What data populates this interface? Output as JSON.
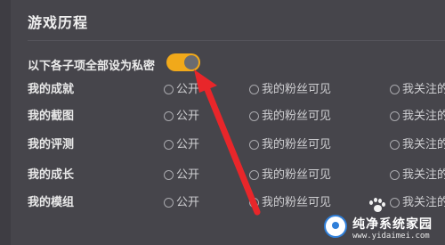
{
  "section": {
    "title": "游戏历程"
  },
  "privacy": {
    "label": "以下各子项全部设为私密",
    "toggle_on": true
  },
  "options": {
    "public": "公开",
    "fans": "我的粉丝可见",
    "follow": "我关注的"
  },
  "rows": [
    {
      "label": "我的成就"
    },
    {
      "label": "我的截图"
    },
    {
      "label": "我的评测"
    },
    {
      "label": "我的成长"
    },
    {
      "label": "我的模组"
    }
  ],
  "watermark": {
    "title": "纯净系统家园",
    "url": "www.yidaimei.com"
  },
  "colors": {
    "background": "#46454b",
    "toggle_on": "#f1a91a",
    "arrow": "#e8262a"
  }
}
